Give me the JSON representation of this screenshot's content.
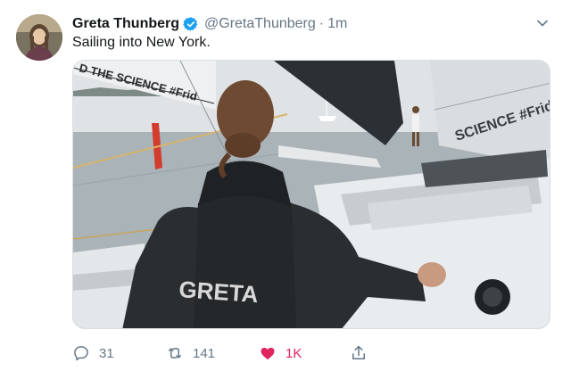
{
  "tweet": {
    "author_name": "Greta Thunberg",
    "handle": "@GretaThunberg",
    "separator": "·",
    "time": "1m",
    "text": "Sailing into New York."
  },
  "media": {
    "banner_text_left": "D THE SCIENCE #Frid",
    "banner_text_right": "SCIENCE #Frid",
    "jacket_text": "GRETA"
  },
  "actions": {
    "reply_count": "31",
    "retweet_count": "141",
    "like_count": "1K"
  },
  "colors": {
    "verified": "#1da1f2",
    "like": "#e0245e",
    "muted": "#657786"
  },
  "icons": {
    "verified": "verified-badge-icon",
    "caret": "chevron-down-icon",
    "reply": "reply-icon",
    "retweet": "retweet-icon",
    "like": "heart-icon",
    "share": "share-icon"
  }
}
